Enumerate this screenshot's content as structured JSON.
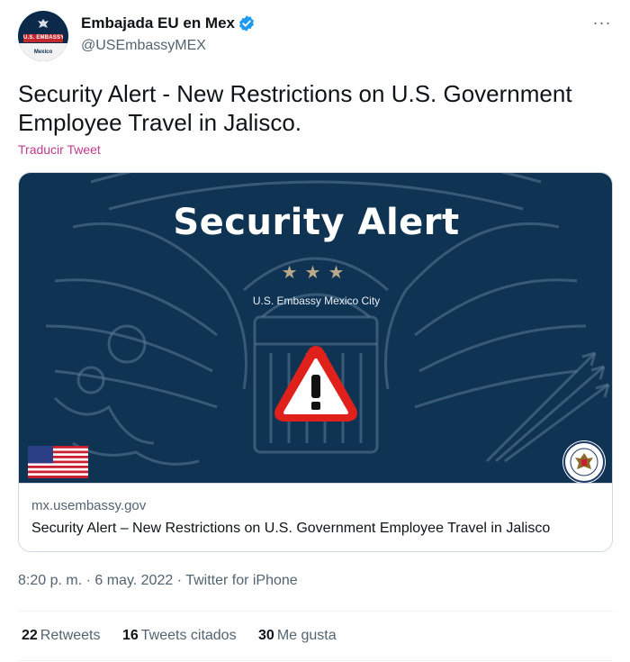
{
  "account": {
    "display_name": "Embajada EU en Mex",
    "handle": "@USEmbassyMEX",
    "avatar_banner": "U.S. EMBASSY",
    "avatar_bottom": "Mexico",
    "verified": true
  },
  "more_label": "···",
  "tweet": {
    "text": "Security Alert - New Restrictions on U.S. Government Employee Travel in Jalisco.",
    "translate_label": "Traducir Tweet"
  },
  "card": {
    "image_title": "Security Alert",
    "image_stars": "★★★",
    "image_subtitle": "U.S. Embassy Mexico City",
    "domain": "mx.usembassy.gov",
    "title": "Security Alert – New Restrictions on U.S. Government Employee Travel in Jalisco"
  },
  "meta": {
    "time": "8:20 p. m.",
    "sep1": " · ",
    "date": "6 may. 2022",
    "sep2": " · ",
    "source": "Twitter for iPhone"
  },
  "stats": {
    "retweets_count": "22",
    "retweets_label": "Retweets",
    "quotes_count": "16",
    "quotes_label": "Tweets citados",
    "likes_count": "30",
    "likes_label": "Me gusta"
  },
  "colors": {
    "verified_blue": "#1d9bf0",
    "translate_pink": "#c13b8e",
    "card_bg": "#0f3353",
    "warning_red": "#e0201b"
  }
}
